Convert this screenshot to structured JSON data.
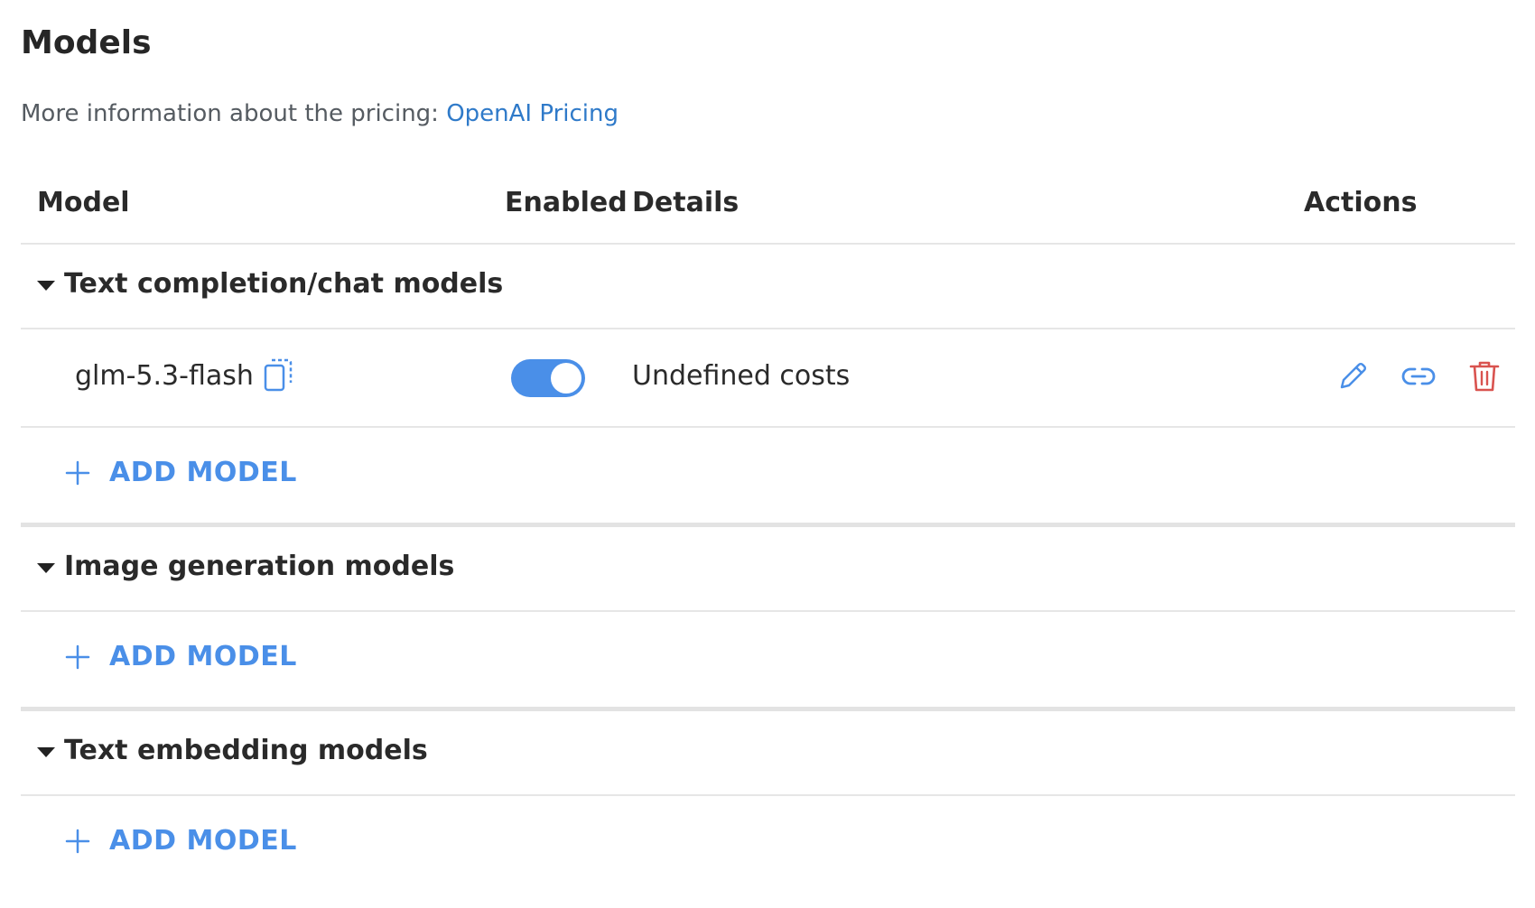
{
  "page": {
    "title": "Models",
    "pricing_prefix": "More information about the pricing: ",
    "pricing_link": "OpenAI Pricing"
  },
  "table": {
    "headers": {
      "model": "Model",
      "enabled": "Enabled",
      "details": "Details",
      "actions": "Actions"
    },
    "groups": [
      {
        "label": "Text completion/chat models",
        "expanded": true,
        "models": [
          {
            "name": "glm-5.3-flash",
            "enabled": true,
            "details": "Undefined costs",
            "actions": [
              "edit-icon",
              "link-icon",
              "trash-icon"
            ]
          }
        ],
        "add_label": "ADD MODEL"
      },
      {
        "label": "Image generation models",
        "expanded": true,
        "models": [],
        "add_label": "ADD MODEL"
      },
      {
        "label": "Text embedding models",
        "expanded": true,
        "models": [],
        "add_label": "ADD MODEL"
      }
    ]
  },
  "colors": {
    "accent": "#4a8fe8",
    "link": "#2f7ac9",
    "danger": "#d9534f",
    "border": "#e6e6e6"
  }
}
